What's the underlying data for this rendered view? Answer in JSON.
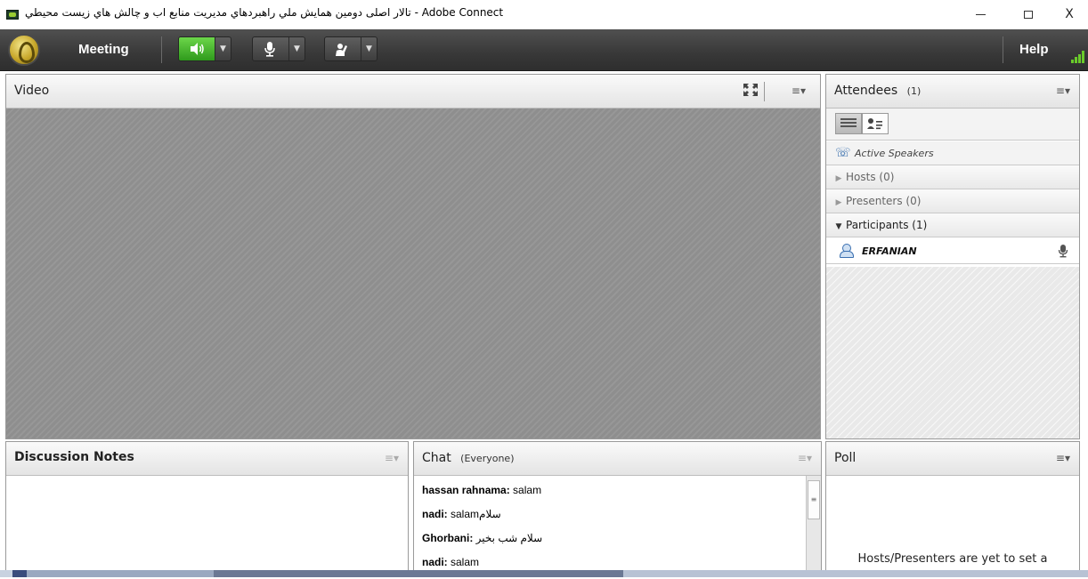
{
  "window": {
    "title": "تالار اصلی دومین همایش ملي راهبردهاي مديريت منابع اب و چالش هاي زيست محيطي - Adobe Connect",
    "minimize_symbol": "",
    "maximize_symbol": "",
    "close_symbol": "X"
  },
  "menubar": {
    "meeting_label": "Meeting",
    "help_label": "Help",
    "speaker_icon": "speaker-icon",
    "mic_icon": "microphone-icon",
    "hand_icon": "raise-hand-icon",
    "speaker_active_color": "#44b52c"
  },
  "video_pod": {
    "title": "Video",
    "menu_glyph": "≡▾"
  },
  "attendees_pod": {
    "title": "Attendees",
    "count": "(1)",
    "menu_glyph": "≡▾",
    "active_speakers_label": "Active Speakers",
    "groups": [
      {
        "label": "Hosts (0)",
        "expanded": false
      },
      {
        "label": "Presenters (0)",
        "expanded": false
      },
      {
        "label": "Participants (1)",
        "expanded": true
      }
    ],
    "participants": [
      {
        "name": "ERFANIAN"
      }
    ]
  },
  "notes_pod": {
    "title": "Discussion Notes",
    "menu_glyph": "≡▾"
  },
  "chat_pod": {
    "title": "Chat",
    "scope": "(Everyone)",
    "menu_glyph": "≡▾",
    "messages": [
      {
        "sender": "hassan rahnama:",
        "text": " salam"
      },
      {
        "sender": "nadi:",
        "text": " salamسلام"
      },
      {
        "sender": "Ghorbani:",
        "text": " سلام شب بخیر"
      },
      {
        "sender": "nadi:",
        "text": " salam"
      }
    ]
  },
  "poll_pod": {
    "title": "Poll",
    "menu_glyph": "≡▾",
    "message": "Hosts/Presenters are yet to set a"
  }
}
